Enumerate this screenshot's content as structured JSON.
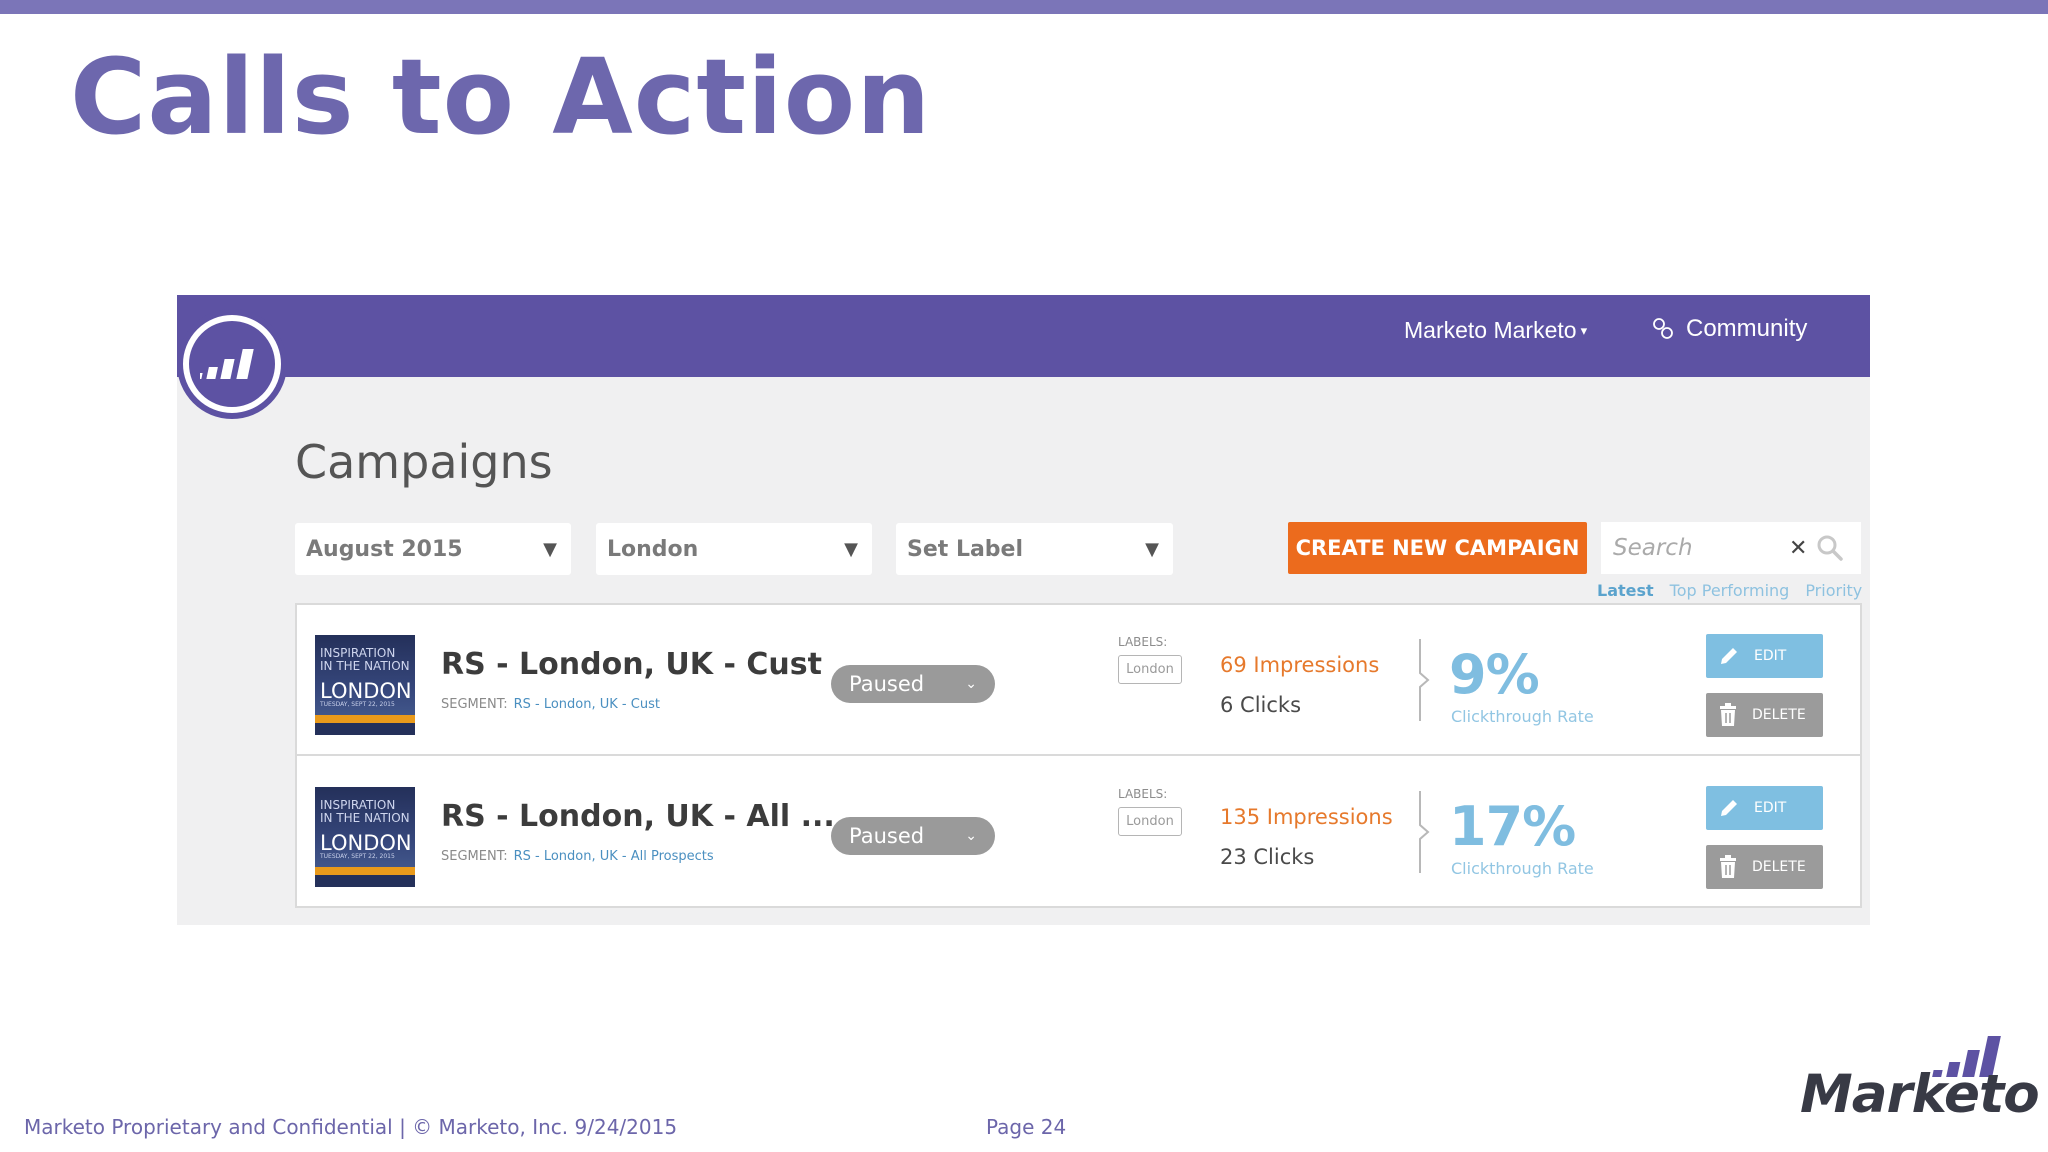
{
  "slide": {
    "title": "Calls to Action",
    "footer": "Marketo Proprietary and Confidential  |  © Marketo, Inc.  9/24/2015",
    "page": "Page 24",
    "brand": "Marketo"
  },
  "app": {
    "header": {
      "user_menu": "Marketo Marketo",
      "community": "Community"
    },
    "page_heading": "Campaigns",
    "filters": [
      {
        "value": "August 2015"
      },
      {
        "value": "London"
      },
      {
        "value": "Set Label"
      }
    ],
    "create_button": "CREATE NEW CAMPAIGN",
    "search": {
      "placeholder": "Search"
    },
    "sort": {
      "latest": "Latest",
      "top": "Top Performing",
      "priority": "Priority"
    },
    "campaigns": [
      {
        "thumb_lines": [
          "INSPIRATION",
          "IN THE NATION",
          "LONDON",
          "TUESDAY, SEPT 22, 2015"
        ],
        "title": "RS - London, UK - Cust",
        "segment_label": "SEGMENT:",
        "segment": "RS - London, UK - Cust",
        "status": "Paused",
        "labels_caption": "LABELS:",
        "label": "London",
        "impressions": "69 Impressions",
        "clicks": "6 Clicks",
        "ctr": "9%",
        "ctr_label": "Clickthrough Rate",
        "edit": "EDIT",
        "delete": "DELETE"
      },
      {
        "thumb_lines": [
          "INSPIRATION",
          "IN THE NATION",
          "LONDON",
          "TUESDAY, SEPT 22, 2015"
        ],
        "title": "RS - London, UK - All ...",
        "segment_label": "SEGMENT:",
        "segment": "RS - London, UK - All Prospects",
        "status": "Paused",
        "labels_caption": "LABELS:",
        "label": "London",
        "impressions": "135 Impressions",
        "clicks": "23 Clicks",
        "ctr": "17%",
        "ctr_label": "Clickthrough Rate",
        "edit": "EDIT",
        "delete": "DELETE"
      }
    ]
  },
  "colors": {
    "slide_accent": "#6d67ad",
    "header_purple": "#5d52a3",
    "cta_orange": "#ec6b1d",
    "impressions_orange": "#e6792c",
    "ctr_blue": "#7fbde0"
  }
}
